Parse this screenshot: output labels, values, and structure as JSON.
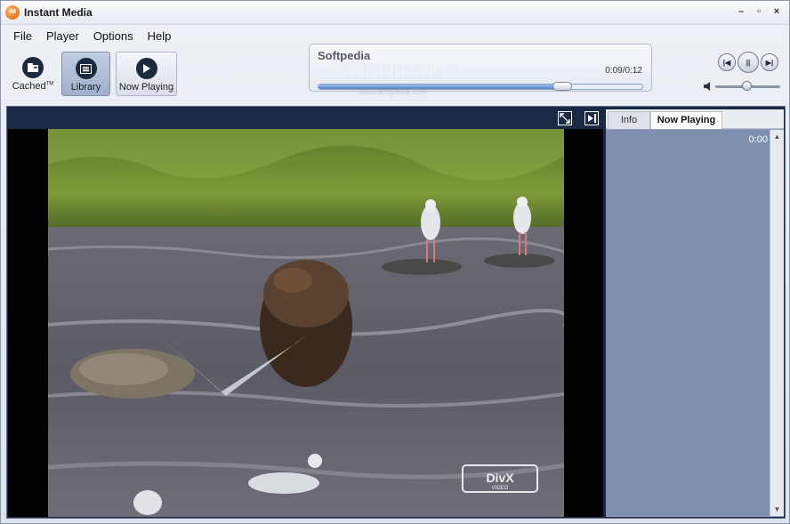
{
  "window": {
    "title": "Instant Media",
    "logo_text": "IM"
  },
  "window_controls": {
    "minimize": "–",
    "maximize": "▫",
    "close": "×"
  },
  "menu": [
    "File",
    "Player",
    "Options",
    "Help"
  ],
  "toolbar": {
    "cached_label": "Cached",
    "cached_mark": "TM",
    "library_label": "Library",
    "now_playing_label": "Now Playing"
  },
  "display": {
    "title": "Softpedia",
    "watermark": "SOFTPEDIA",
    "watermark_trademark": "™",
    "watermark_url": "www.softpedia.com",
    "time": "0:09/0:12",
    "progress_fraction": 0.75
  },
  "transport": {
    "prev": "|◀",
    "pause": "||",
    "next": "▶|"
  },
  "volume": {
    "level_fraction": 0.49
  },
  "side_panel": {
    "tabs": [
      "Info",
      "Now Playing"
    ],
    "active_tab": "Now Playing",
    "time": "0:00"
  },
  "video": {
    "overlay_logo": "DivX",
    "overlay_sub": "VIDEO"
  },
  "colors": {
    "frame": "#1a2a44",
    "side_list": "#7e8fb0",
    "accent": "#4f82c8"
  }
}
